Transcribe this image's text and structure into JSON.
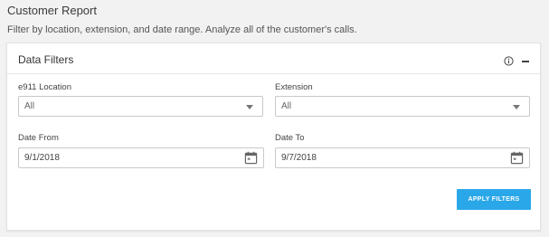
{
  "page": {
    "title": "Customer Report",
    "subtitle": "Filter by location, extension, and date range. Analyze all of the customer's calls."
  },
  "filters": {
    "title": "Data Filters",
    "info_icon": "info-icon",
    "collapse_icon": "collapse-icon",
    "location": {
      "label": "e911 Location",
      "value": "All"
    },
    "extension": {
      "label": "Extension",
      "value": "All"
    },
    "date_from": {
      "label": "Date From",
      "value": "9/1/2018"
    },
    "date_to": {
      "label": "Date To",
      "value": "9/7/2018"
    },
    "apply_label": "APPLY FILTERS"
  },
  "colors": {
    "accent": "#2aa7e8",
    "background": "#f2f2f2",
    "card": "#ffffff"
  }
}
